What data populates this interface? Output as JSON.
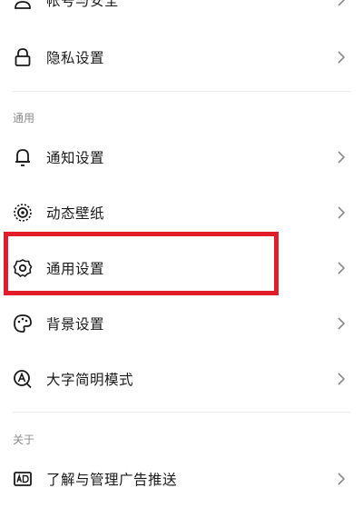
{
  "settings": {
    "items": [
      {
        "id": "account-security",
        "label": "帐号与安全",
        "icon": "person-icon"
      },
      {
        "id": "privacy",
        "label": "隐私设置",
        "icon": "lock-icon"
      },
      {
        "id": "notification",
        "label": "通知设置",
        "icon": "bell-icon"
      },
      {
        "id": "live-wallpaper",
        "label": "动态壁纸",
        "icon": "dynamic-wallpaper-icon"
      },
      {
        "id": "general",
        "label": "通用设置",
        "icon": "gear-icon"
      },
      {
        "id": "background",
        "label": "背景设置",
        "icon": "palette-icon"
      },
      {
        "id": "large-font",
        "label": "大字简明模式",
        "icon": "large-font-icon"
      },
      {
        "id": "ads",
        "label": "了解与管理广告推送",
        "icon": "ad-icon"
      }
    ],
    "sections": {
      "general": "通用",
      "about": "关于"
    }
  },
  "highlight": {
    "color": "#e21d2a",
    "target": "general"
  }
}
